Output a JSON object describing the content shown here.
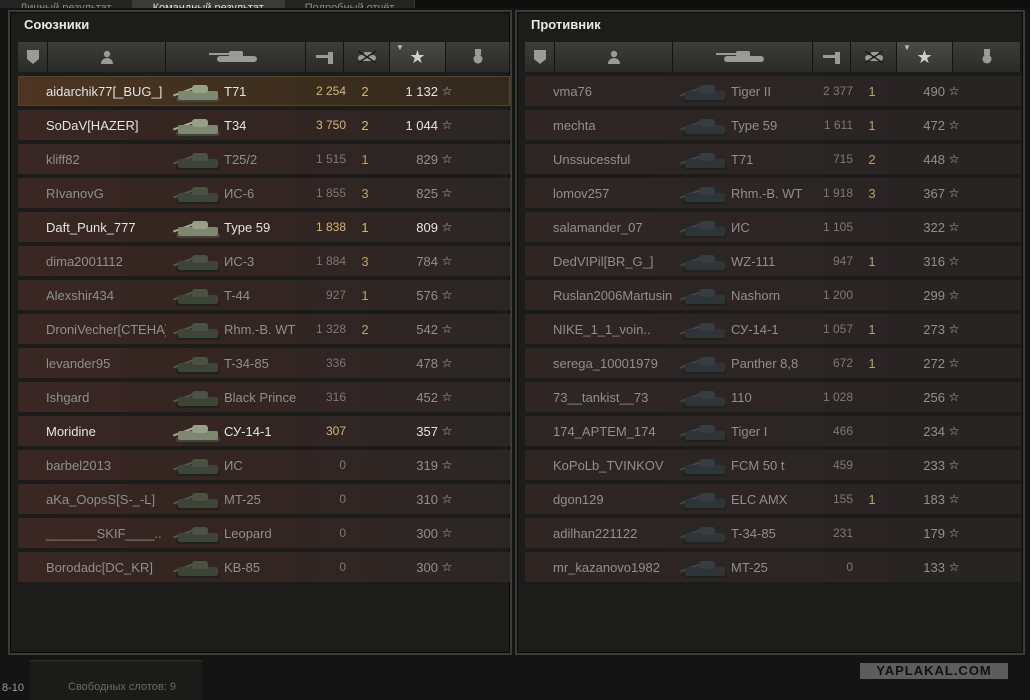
{
  "tabs": [
    {
      "label": "Личный результат"
    },
    {
      "label": "Командный результат"
    },
    {
      "label": "Подробный отчёт"
    }
  ],
  "allies": {
    "title": "Союзники",
    "rows": [
      {
        "name": "aidarchik77[_BUG_]",
        "tank": "T71",
        "damage": "2 254",
        "kills": "2",
        "xp": "1 132",
        "alive": true,
        "player": true
      },
      {
        "name": "SoDaV[HAZER]",
        "tank": "T34",
        "damage": "3 750",
        "kills": "2",
        "xp": "1 044",
        "alive": true
      },
      {
        "name": "kliff82",
        "tank": "T25/2",
        "damage": "1 515",
        "kills": "1",
        "xp": "829",
        "alive": false
      },
      {
        "name": "RIvanovG",
        "tank": "ИС-6",
        "damage": "1 855",
        "kills": "3",
        "xp": "825",
        "alive": false
      },
      {
        "name": "Daft_Punk_777",
        "tank": "Type 59",
        "damage": "1 838",
        "kills": "1",
        "xp": "809",
        "alive": true
      },
      {
        "name": "dima2001112",
        "tank": "ИС-3",
        "damage": "1 884",
        "kills": "3",
        "xp": "784",
        "alive": false
      },
      {
        "name": "Alexshir434",
        "tank": "T-44",
        "damage": "927",
        "kills": "1",
        "xp": "576",
        "alive": false
      },
      {
        "name": "DroniVecher[СТЕНА]",
        "tank": "Rhm.-B. WT",
        "damage": "1 328",
        "kills": "2",
        "xp": "542",
        "alive": false
      },
      {
        "name": "levander95",
        "tank": "T-34-85",
        "damage": "336",
        "kills": "",
        "xp": "478",
        "alive": false
      },
      {
        "name": "Ishgard",
        "tank": "Black Prince",
        "damage": "316",
        "kills": "",
        "xp": "452",
        "alive": false
      },
      {
        "name": "Moridine",
        "tank": "СУ-14-1",
        "damage": "307",
        "kills": "",
        "xp": "357",
        "alive": true
      },
      {
        "name": "barbel2013",
        "tank": "ИС",
        "damage": "0",
        "kills": "",
        "xp": "319",
        "alive": false
      },
      {
        "name": "aKa_OopsS[S-_-L]",
        "tank": "MT-25",
        "damage": "0",
        "kills": "",
        "xp": "310",
        "alive": false
      },
      {
        "name": "_______SKIF____..",
        "tank": "Leopard",
        "damage": "0",
        "kills": "",
        "xp": "300",
        "alive": false
      },
      {
        "name": "Borodadc[DC_KR]",
        "tank": "KB-85",
        "damage": "0",
        "kills": "",
        "xp": "300",
        "alive": false
      }
    ]
  },
  "enemies": {
    "title": "Противник",
    "rows": [
      {
        "name": "vma76",
        "tank": "Tiger II",
        "damage": "2 377",
        "kills": "1",
        "xp": "490"
      },
      {
        "name": "mechta",
        "tank": "Type 59",
        "damage": "1 611",
        "kills": "1",
        "xp": "472"
      },
      {
        "name": "Unssucessful",
        "tank": "T71",
        "damage": "715",
        "kills": "2",
        "xp": "448"
      },
      {
        "name": "lomov257",
        "tank": "Rhm.-B. WT",
        "damage": "1 918",
        "kills": "3",
        "xp": "367"
      },
      {
        "name": "salamander_07",
        "tank": "ИС",
        "damage": "1 105",
        "kills": "",
        "xp": "322"
      },
      {
        "name": "DedVIPil[BR_G_]",
        "tank": "WZ-111",
        "damage": "947",
        "kills": "1",
        "xp": "316"
      },
      {
        "name": "Ruslan2006Martusin..",
        "tank": "Nashorn",
        "damage": "1 200",
        "kills": "",
        "xp": "299"
      },
      {
        "name": "NIKE_1_1_voin..",
        "tank": "СУ-14-1",
        "damage": "1 057",
        "kills": "1",
        "xp": "273"
      },
      {
        "name": "serega_10001979",
        "tank": "Panther 8,8",
        "damage": "672",
        "kills": "1",
        "xp": "272"
      },
      {
        "name": "73__tankist__73",
        "tank": "110",
        "damage": "1 028",
        "kills": "",
        "xp": "256"
      },
      {
        "name": "174_APTEM_174",
        "tank": "Tiger I",
        "damage": "466",
        "kills": "",
        "xp": "234"
      },
      {
        "name": "KoPoLb_TVINKOV",
        "tank": "FCM 50 t",
        "damage": "459",
        "kills": "",
        "xp": "233"
      },
      {
        "name": "dgon129",
        "tank": "ELC AMX",
        "damage": "155",
        "kills": "1",
        "xp": "183"
      },
      {
        "name": "adilhan221122",
        "tank": "T-34-85",
        "damage": "231",
        "kills": "",
        "xp": "179"
      },
      {
        "name": "mr_kazanovo1982",
        "tank": "MT-25",
        "damage": "0",
        "kills": "",
        "xp": "133"
      }
    ]
  },
  "header_icons": [
    "squad-icon",
    "player-icon",
    "tank-icon",
    "damage-icon",
    "kills-icon",
    "xp-star-icon",
    "medal-icon"
  ],
  "footer": {
    "watermark": "YAPLAKAL.COM",
    "left_text": "8-10",
    "left_text2": "Свободных слотов: 9"
  },
  "colors": {
    "accent_gold": "#d6b86c",
    "ally_row": "#3a2723",
    "enemy_row": "#2f2624"
  }
}
